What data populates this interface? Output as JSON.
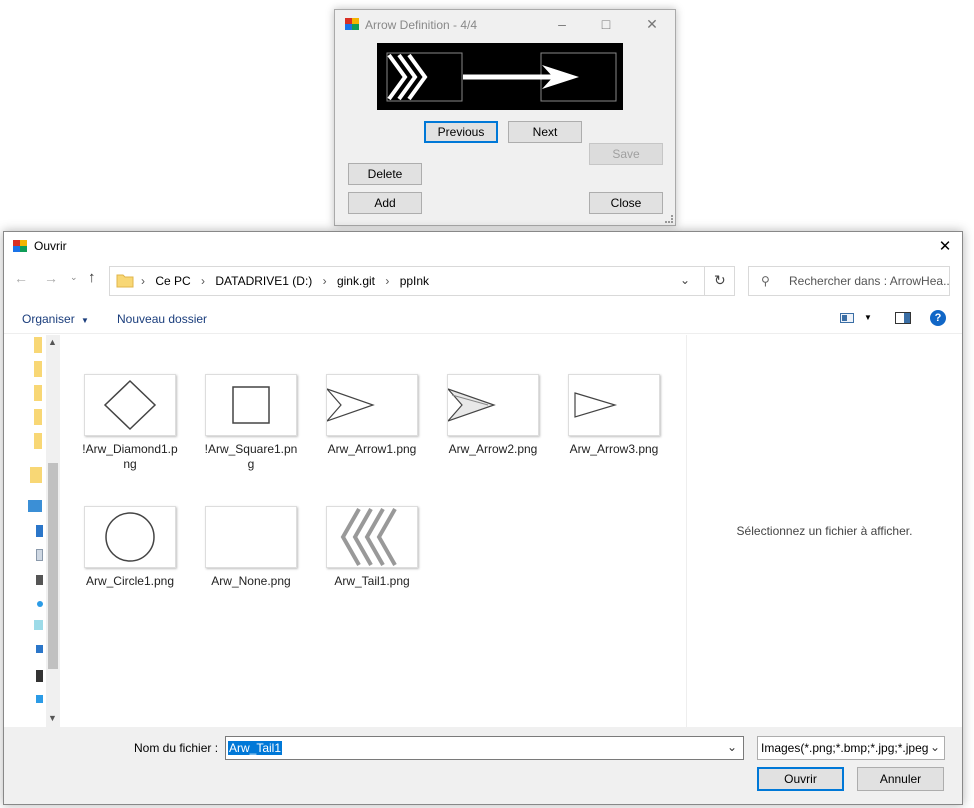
{
  "arrow_dialog": {
    "title": "Arrow Definition - 4/4",
    "buttons": {
      "previous": "Previous",
      "next": "Next",
      "save": "Save",
      "delete": "Delete",
      "add": "Add",
      "close": "Close"
    }
  },
  "open_dialog": {
    "title": "Ouvrir",
    "breadcrumb": [
      "Ce PC",
      "DATADRIVE1 (D:)",
      "gink.git",
      "ppInk"
    ],
    "search_placeholder": "Rechercher dans : ArrowHea...",
    "toolbar": {
      "organize": "Organiser",
      "new_folder": "Nouveau dossier"
    },
    "files": [
      {
        "name": "!Arw_Diamond1.png",
        "icon": "diamond-icon"
      },
      {
        "name": "!Arw_Square1.png",
        "icon": "square-icon"
      },
      {
        "name": "Arw_Arrow1.png",
        "icon": "arrow-head-icon"
      },
      {
        "name": "Arw_Arrow2.png",
        "icon": "arrow-head-icon"
      },
      {
        "name": "Arw_Arrow3.png",
        "icon": "triangle-icon"
      },
      {
        "name": "Arw_Circle1.png",
        "icon": "circle-icon"
      },
      {
        "name": "Arw_None.png",
        "icon": "empty-icon"
      },
      {
        "name": "Arw_Tail1.png",
        "icon": "chevron-tail-icon"
      }
    ],
    "preview_text": "Sélectionnez un fichier à afficher.",
    "filename_label": "Nom du fichier :",
    "filename_value": "Arw_Tail1",
    "filetype_value": "Images(*.png;*.bmp;*.jpg;*.jpeg",
    "open_button": "Ouvrir",
    "cancel_button": "Annuler"
  }
}
